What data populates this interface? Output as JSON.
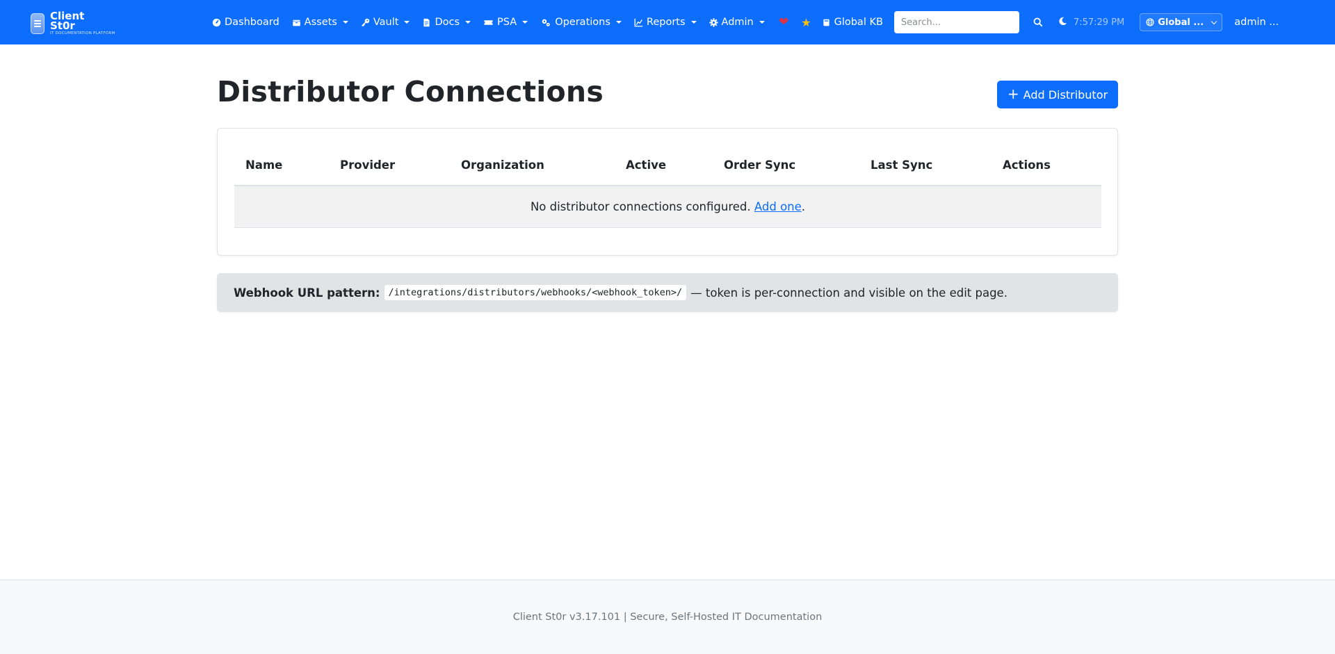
{
  "brand": {
    "name_line1": "Client",
    "name_line2": "St0r",
    "tagline": "IT DOCUMENTATION PLATFORM"
  },
  "nav": {
    "items": [
      {
        "label": "Dashboard",
        "icon": "gauge-icon",
        "dropdown": false
      },
      {
        "label": "Assets",
        "icon": "box-icon",
        "dropdown": true
      },
      {
        "label": "Vault",
        "icon": "key-icon",
        "dropdown": true
      },
      {
        "label": "Docs",
        "icon": "document-icon",
        "dropdown": true
      },
      {
        "label": "PSA",
        "icon": "ticket-icon",
        "dropdown": true
      },
      {
        "label": "Operations",
        "icon": "gears-icon",
        "dropdown": true
      },
      {
        "label": "Reports",
        "icon": "chart-icon",
        "dropdown": true
      },
      {
        "label": "Admin",
        "icon": "gear-icon",
        "dropdown": true
      }
    ],
    "global_kb": "Global KB",
    "search_placeholder": "Search...",
    "clock": "7:57:29 PM",
    "scope": "Global ...",
    "user": "admin ..."
  },
  "page": {
    "title": "Distributor Connections",
    "add_button": "Add Distributor"
  },
  "table": {
    "columns": [
      "Name",
      "Provider",
      "Organization",
      "Active",
      "Order Sync",
      "Last Sync",
      "Actions"
    ],
    "empty_text": "No distributor connections configured.",
    "empty_link": "Add one",
    "empty_suffix": "."
  },
  "webhook": {
    "label": "Webhook URL pattern:",
    "pattern": "/integrations/distributors/webhooks/<webhook_token>/",
    "note": "— token is per-connection and visible on the edit page."
  },
  "footer": {
    "text": "Client St0r v3.17.101 | Secure, Self-Hosted IT Documentation"
  },
  "colors": {
    "primary": "#0d6efd",
    "heart": "#dc3545",
    "star": "#ffc107"
  }
}
